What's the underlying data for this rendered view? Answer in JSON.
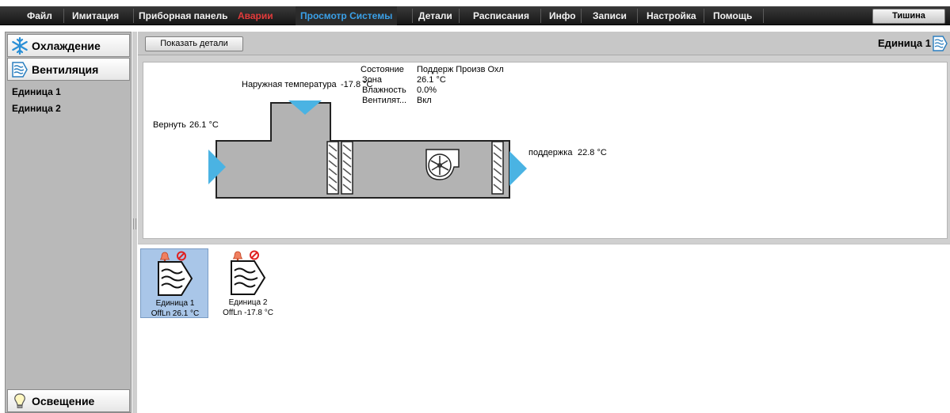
{
  "menu": {
    "items": [
      "Файл",
      "Имитация",
      "Приборная панель",
      "Аварии",
      "Просмотр Системы",
      "Детали",
      "Расписания",
      "Инфо",
      "Записи",
      "Настройка",
      "Помощь"
    ],
    "silence_label": "Тишина"
  },
  "sidebar": {
    "cooling_label": "Охлаждение",
    "ventilation_label": "Вентиляция",
    "units": [
      "Единица 1",
      "Единица 2"
    ],
    "lighting_label": "Освещение"
  },
  "toolbar": {
    "details_button": "Показать детали",
    "unit_title": "Единица 1"
  },
  "status": {
    "labels": [
      "Состояние",
      "Зона",
      "Влажность",
      "Вентилят..."
    ],
    "values": [
      "Поддерж Произв Охл",
      "26.1 °C",
      "0.0%",
      "Вкл"
    ]
  },
  "diagram": {
    "outdoor_label": "Наружная температура",
    "outdoor_value": "-17.8 °C",
    "return_label": "Вернуть",
    "return_value": "26.1 °C",
    "supply_label": "поддержка",
    "supply_value": "22.8 °C"
  },
  "tiles": [
    {
      "name": "Единица 1",
      "status": "OffLn 26.1 °C"
    },
    {
      "name": "Единица 2",
      "status": "OffLn -17.8 °C"
    }
  ],
  "colors": {
    "accent": "#3aa0e8",
    "alarm": "#e23b3b",
    "arrow": "#4ab3e3",
    "duct": "#b3b3b3"
  }
}
